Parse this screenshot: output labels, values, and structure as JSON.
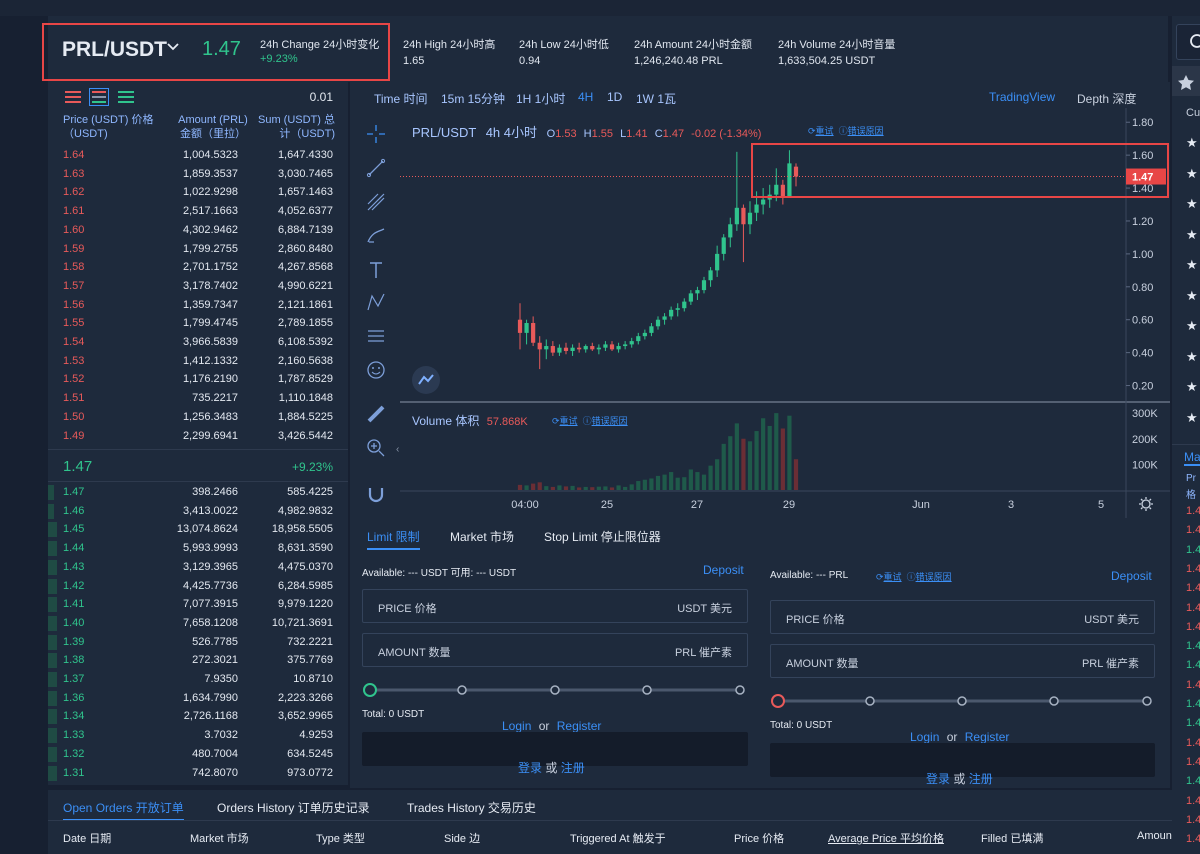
{
  "ticker": {
    "pair": "PRL/USDT",
    "last_price": "1.47",
    "change_label": "24h Change 24小时变化",
    "change_value": "+9.23%",
    "high_label": "24h High 24小时高",
    "high_value": "1.65",
    "low_label": "24h Low 24小时低",
    "low_value": "0.94",
    "amount_label": "24h Amount 24小时金额",
    "amount_value": "1,246,240.48 PRL",
    "volume_label": "24h Volume 24小时音量",
    "volume_value": "1,633,504.25 USDT"
  },
  "orderbook": {
    "precision": "0.01",
    "col_price": "Price (USDT) 价格（USDT)",
    "col_amount": "Amount (PRL) 金额（里拉）",
    "col_sum": "Sum (USDT) 总计（USDT)",
    "mid_price": "1.47",
    "mid_change": "+9.23%",
    "asks": [
      {
        "price": "1.64",
        "amount": "1,004.5323",
        "sum": "1,647.4330"
      },
      {
        "price": "1.63",
        "amount": "1,859.3537",
        "sum": "3,030.7465"
      },
      {
        "price": "1.62",
        "amount": "1,022.9298",
        "sum": "1,657.1463"
      },
      {
        "price": "1.61",
        "amount": "2,517.1663",
        "sum": "4,052.6377"
      },
      {
        "price": "1.60",
        "amount": "4,302.9462",
        "sum": "6,884.7139"
      },
      {
        "price": "1.59",
        "amount": "1,799.2755",
        "sum": "2,860.8480"
      },
      {
        "price": "1.58",
        "amount": "2,701.1752",
        "sum": "4,267.8568"
      },
      {
        "price": "1.57",
        "amount": "3,178.7402",
        "sum": "4,990.6221"
      },
      {
        "price": "1.56",
        "amount": "1,359.7347",
        "sum": "2,121.1861"
      },
      {
        "price": "1.55",
        "amount": "1,799.4745",
        "sum": "2,789.1855"
      },
      {
        "price": "1.54",
        "amount": "3,966.5839",
        "sum": "6,108.5392"
      },
      {
        "price": "1.53",
        "amount": "1,412.1332",
        "sum": "2,160.5638"
      },
      {
        "price": "1.52",
        "amount": "1,176.2190",
        "sum": "1,787.8529"
      },
      {
        "price": "1.51",
        "amount": "735.2217",
        "sum": "1,110.1848"
      },
      {
        "price": "1.50",
        "amount": "1,256.3483",
        "sum": "1,884.5225"
      },
      {
        "price": "1.49",
        "amount": "2,299.6941",
        "sum": "3,426.5442"
      }
    ],
    "bids": [
      {
        "price": "1.47",
        "amount": "398.2466",
        "sum": "585.4225",
        "depth": 0.02
      },
      {
        "price": "1.46",
        "amount": "3,413.0022",
        "sum": "4,982.9832",
        "depth": 0.02
      },
      {
        "price": "1.45",
        "amount": "13,074.8624",
        "sum": "18,958.5505",
        "depth": 0.03
      },
      {
        "price": "1.44",
        "amount": "5,993.9993",
        "sum": "8,631.3590",
        "depth": 0.03
      },
      {
        "price": "1.43",
        "amount": "3,129.3965",
        "sum": "4,475.0370",
        "depth": 0.03
      },
      {
        "price": "1.42",
        "amount": "4,425.7736",
        "sum": "6,284.5985",
        "depth": 0.03
      },
      {
        "price": "1.41",
        "amount": "7,077.3915",
        "sum": "9,979.1220",
        "depth": 0.03
      },
      {
        "price": "1.40",
        "amount": "7,658.1208",
        "sum": "10,721.3691",
        "depth": 0.03
      },
      {
        "price": "1.39",
        "amount": "526.7785",
        "sum": "732.2221",
        "depth": 0.03
      },
      {
        "price": "1.38",
        "amount": "272.3021",
        "sum": "375.7769",
        "depth": 0.03
      },
      {
        "price": "1.37",
        "amount": "7.9350",
        "sum": "10.8710",
        "depth": 0.03
      },
      {
        "price": "1.36",
        "amount": "1,634.7990",
        "sum": "2,223.3266",
        "depth": 0.03
      },
      {
        "price": "1.34",
        "amount": "2,726.1168",
        "sum": "3,652.9965",
        "depth": 0.03
      },
      {
        "price": "1.33",
        "amount": "3.7032",
        "sum": "4.9253",
        "depth": 0.03
      },
      {
        "price": "1.32",
        "amount": "480.7004",
        "sum": "634.5245",
        "depth": 0.03
      },
      {
        "price": "1.31",
        "amount": "742.8070",
        "sum": "973.0772",
        "depth": 0.03
      }
    ]
  },
  "chart": {
    "intervals": [
      "Time 时间",
      "15m 15分钟",
      "1H 1小时",
      "4H",
      "1D",
      "1W 1瓦"
    ],
    "active_interval": "4H",
    "tradingview": "TradingView",
    "depth": "Depth 深度",
    "legend_pair": "PRL/USDT",
    "legend_tf": "4h 4小时",
    "o_label": "O",
    "o": "1.53",
    "h_label": "H",
    "h": "1.55",
    "l_label": "L",
    "l": "1.41",
    "c_label": "C",
    "c": "1.47",
    "change": "-0.02 (-1.34%)",
    "retry": "重试",
    "error": "错误原因",
    "volume_label": "Volume 体积",
    "volume_value": "57.868K",
    "price_ticks": [
      "1.80",
      "1.60",
      "1.40",
      "1.20",
      "1.00",
      "0.80",
      "0.60",
      "0.40",
      "0.20"
    ],
    "current_price_tag": "1.47",
    "vol_ticks": [
      "300K",
      "200K",
      "100K"
    ],
    "time_ticks": [
      "04:00",
      "25",
      "27",
      "29",
      "Jun",
      "3",
      "5"
    ]
  },
  "chart_data": {
    "type": "candlestick",
    "ylim": [
      0.1,
      1.85
    ],
    "candles": [
      [
        0.6,
        0.7,
        0.42,
        0.52
      ],
      [
        0.52,
        0.6,
        0.45,
        0.58
      ],
      [
        0.58,
        0.62,
        0.44,
        0.46
      ],
      [
        0.46,
        0.5,
        0.3,
        0.42
      ],
      [
        0.42,
        0.48,
        0.36,
        0.44
      ],
      [
        0.44,
        0.47,
        0.38,
        0.4
      ],
      [
        0.4,
        0.45,
        0.38,
        0.43
      ],
      [
        0.43,
        0.46,
        0.39,
        0.41
      ],
      [
        0.41,
        0.45,
        0.38,
        0.43
      ],
      [
        0.43,
        0.46,
        0.4,
        0.42
      ],
      [
        0.42,
        0.45,
        0.4,
        0.44
      ],
      [
        0.44,
        0.46,
        0.41,
        0.42
      ],
      [
        0.42,
        0.45,
        0.39,
        0.43
      ],
      [
        0.43,
        0.47,
        0.41,
        0.45
      ],
      [
        0.45,
        0.47,
        0.41,
        0.42
      ],
      [
        0.42,
        0.46,
        0.4,
        0.44
      ],
      [
        0.44,
        0.47,
        0.42,
        0.45
      ],
      [
        0.45,
        0.49,
        0.43,
        0.47
      ],
      [
        0.47,
        0.52,
        0.45,
        0.5
      ],
      [
        0.5,
        0.54,
        0.48,
        0.52
      ],
      [
        0.52,
        0.58,
        0.5,
        0.56
      ],
      [
        0.56,
        0.62,
        0.54,
        0.6
      ],
      [
        0.6,
        0.64,
        0.57,
        0.62
      ],
      [
        0.62,
        0.68,
        0.6,
        0.66
      ],
      [
        0.66,
        0.7,
        0.62,
        0.67
      ],
      [
        0.67,
        0.73,
        0.65,
        0.71
      ],
      [
        0.71,
        0.78,
        0.69,
        0.76
      ],
      [
        0.76,
        0.8,
        0.72,
        0.78
      ],
      [
        0.78,
        0.86,
        0.76,
        0.84
      ],
      [
        0.84,
        0.92,
        0.8,
        0.9
      ],
      [
        0.9,
        1.05,
        0.86,
        1.0
      ],
      [
        1.0,
        1.12,
        0.96,
        1.1
      ],
      [
        1.1,
        1.22,
        1.04,
        1.18
      ],
      [
        1.18,
        1.62,
        1.14,
        1.28
      ],
      [
        1.28,
        1.3,
        0.95,
        1.18
      ],
      [
        1.18,
        1.32,
        1.12,
        1.25
      ],
      [
        1.25,
        1.38,
        1.2,
        1.3
      ],
      [
        1.3,
        1.4,
        1.24,
        1.33
      ],
      [
        1.33,
        1.42,
        1.28,
        1.36
      ],
      [
        1.36,
        1.52,
        1.32,
        1.42
      ],
      [
        1.42,
        1.45,
        1.3,
        1.35
      ],
      [
        1.35,
        1.63,
        1.34,
        1.55
      ],
      [
        1.53,
        1.55,
        1.41,
        1.47
      ]
    ],
    "volumes": [
      20,
      18,
      25,
      30,
      15,
      12,
      18,
      14,
      16,
      10,
      12,
      11,
      13,
      14,
      10,
      18,
      12,
      22,
      35,
      40,
      45,
      55,
      60,
      70,
      48,
      50,
      80,
      70,
      60,
      95,
      120,
      180,
      210,
      260,
      200,
      190,
      230,
      280,
      250,
      300,
      240,
      290,
      120
    ]
  },
  "trade": {
    "tabs": [
      "Limit 限制",
      "Market 市场",
      "Stop Limit 停止限位器"
    ],
    "buy": {
      "available": "Available: --- USDT 可用: --- USDT",
      "deposit": "Deposit",
      "price_label": "PRICE 价格",
      "price_unit": "USDT 美元",
      "amount_label": "AMOUNT 数量",
      "amount_unit": "PRL 催产素",
      "total": "Total: 0 USDT",
      "login": "Login",
      "or": "or",
      "register": "Register",
      "login_cn": "登录",
      "or_cn": "或",
      "register_cn": "注册"
    },
    "sell": {
      "available": "Available: --- PRL",
      "retry": "重试",
      "error": "错误原因",
      "deposit": "Deposit",
      "price_label": "PRICE 价格",
      "price_unit": "USDT 美元",
      "amount_label": "AMOUNT 数量",
      "amount_unit": "PRL 催产素",
      "total": "Total: 0 USDT",
      "login": "Login",
      "or": "or",
      "register": "Register",
      "login_cn": "登录",
      "or_cn": "或",
      "register_cn": "注册"
    }
  },
  "orders": {
    "tabs": [
      "Open Orders 开放订单",
      "Orders History 订单历史记录",
      "Trades History 交易历史"
    ],
    "columns": [
      "Date 日期",
      "Market 市场",
      "Type 类型",
      "Side 边",
      "Triggered At 触发于",
      "Price 价格",
      "Average Price 平均价格",
      "Filled 已填满",
      "Amount"
    ]
  },
  "right_panel": {
    "label1": "Cur",
    "label2": "Ma",
    "label3": "Pr",
    "label4": "格",
    "values": [
      "1.4",
      "1.4",
      "1.4",
      "1.4",
      "1.4",
      "1.4",
      "1.4",
      "1.4",
      "1.4",
      "1.4",
      "1.4",
      "1.4",
      "1.4",
      "1.4",
      "1.4",
      "1.4",
      "1.4",
      "1.4"
    ]
  },
  "colors": {
    "up": "#30c48d",
    "down": "#e85a5a",
    "accent": "#3b8ff6",
    "highlight": "#e84646"
  }
}
